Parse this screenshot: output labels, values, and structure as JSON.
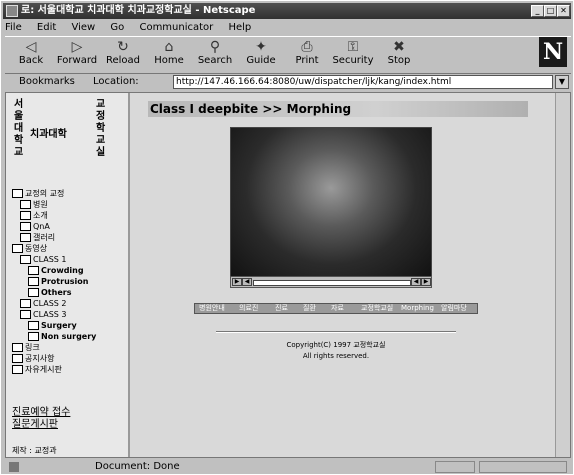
{
  "window": {
    "title": "로: 서울대학교 치과대학 치과교정학교실 - Netscape"
  },
  "menu": [
    "File",
    "Edit",
    "View",
    "Go",
    "Communicator",
    "Help"
  ],
  "toolbar": [
    {
      "label": "Back",
      "icon": "back-arrow-icon",
      "glyph": "◁"
    },
    {
      "label": "Forward",
      "icon": "forward-arrow-icon",
      "glyph": "▷"
    },
    {
      "label": "Reload",
      "icon": "reload-icon",
      "glyph": "↻"
    },
    {
      "label": "Home",
      "icon": "home-icon",
      "glyph": "⌂"
    },
    {
      "label": "Search",
      "icon": "search-icon",
      "glyph": "⚲"
    },
    {
      "label": "Guide",
      "icon": "guide-icon",
      "glyph": "✦"
    },
    {
      "label": "Print",
      "icon": "print-icon",
      "glyph": "⎙"
    },
    {
      "label": "Security",
      "icon": "security-icon",
      "glyph": "⚿"
    },
    {
      "label": "Stop",
      "icon": "stop-icon",
      "glyph": "✖"
    }
  ],
  "location": {
    "bookmarks_label": "Bookmarks",
    "label": "Location:",
    "url": "http://147.46.166.64:8080/uw/dispatcher/ljk/kang/index.html"
  },
  "sidebar": {
    "logo_col1": "서울대학교",
    "logo_mid": "치과대학",
    "logo_col2": "교정학교실",
    "tree": [
      {
        "label": "교정의 교정",
        "indent": 0
      },
      {
        "label": "병원",
        "indent": 1
      },
      {
        "label": "소개",
        "indent": 1
      },
      {
        "label": "QnA",
        "indent": 1
      },
      {
        "label": "갤러리",
        "indent": 1
      },
      {
        "label": "동영상",
        "indent": 0
      },
      {
        "label": "CLASS 1",
        "indent": 1
      },
      {
        "label": "Crowding",
        "indent": 2
      },
      {
        "label": "Protrusion",
        "indent": 2
      },
      {
        "label": "Others",
        "indent": 2
      },
      {
        "label": "CLASS 2",
        "indent": 1
      },
      {
        "label": "CLASS 3",
        "indent": 1
      },
      {
        "label": "Surgery",
        "indent": 2
      },
      {
        "label": "Non surgery",
        "indent": 2
      },
      {
        "label": "링크",
        "indent": 0
      },
      {
        "label": "공지사항",
        "indent": 0
      },
      {
        "label": "자유게시판",
        "indent": 0
      }
    ],
    "footer_links": "진료예약 접수\n질문게시판",
    "footer_small": "제작 : 교정과"
  },
  "main": {
    "heading": "Class I deepbite >> Morphing",
    "nav_strip": [
      "병원안내",
      "의료진",
      "진료",
      "질환",
      "자료",
      "교정학교실",
      "Morphing",
      "알림마당"
    ],
    "copyright": "Copyright(C) 1997 교정학교실",
    "rights": "All rights reserved."
  },
  "status": {
    "text": "Document: Done"
  }
}
